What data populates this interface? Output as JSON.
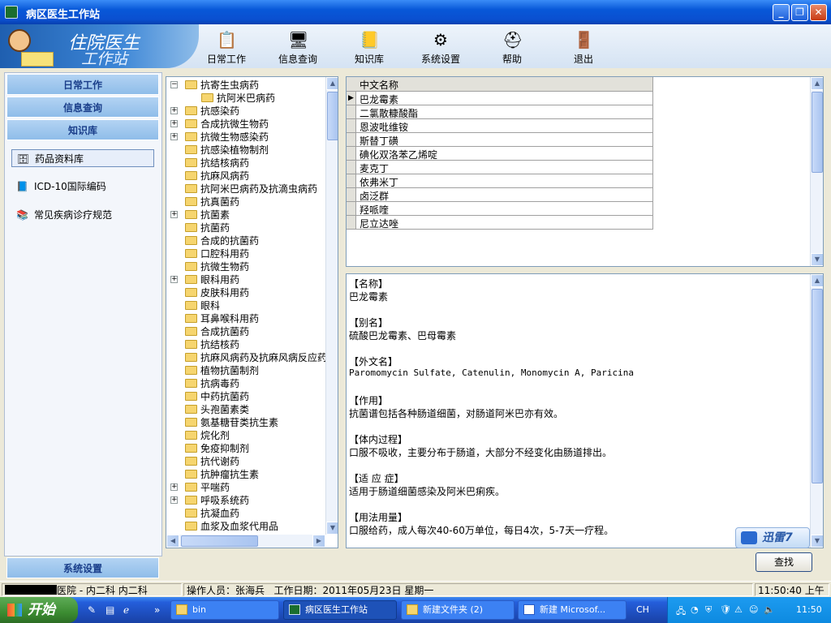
{
  "window": {
    "title": "病区医生工作站"
  },
  "logo": {
    "line1": "住院医生",
    "line2": "工作站"
  },
  "toolbar": [
    {
      "label": "日常工作",
      "icon": "clipboard-icon"
    },
    {
      "label": "信息查询",
      "icon": "search-info-icon"
    },
    {
      "label": "知识库",
      "icon": "book-icon"
    },
    {
      "label": "系统设置",
      "icon": "gear-icon"
    },
    {
      "label": "帮助",
      "icon": "lifebuoy-icon"
    },
    {
      "label": "退出",
      "icon": "exit-icon"
    }
  ],
  "sidebar": {
    "nav": [
      "日常工作",
      "信息查询",
      "知识库"
    ],
    "items": [
      {
        "label": "药品资料库"
      },
      {
        "label": "ICD-10国际编码"
      },
      {
        "label": "常见疾病诊疗规范"
      }
    ],
    "settings": "系统设置"
  },
  "tree": [
    {
      "label": "抗寄生虫病药",
      "exp": "−",
      "lvl": 0
    },
    {
      "label": "抗阿米巴病药",
      "exp": "",
      "lvl": 1
    },
    {
      "label": "抗感染药",
      "exp": "+",
      "lvl": 0
    },
    {
      "label": "合成抗微生物药",
      "exp": "+",
      "lvl": 0
    },
    {
      "label": "抗微生物感染药",
      "exp": "+",
      "lvl": 0
    },
    {
      "label": "抗感染植物制剂",
      "exp": "",
      "lvl": 0
    },
    {
      "label": "抗结核病药",
      "exp": "",
      "lvl": 0
    },
    {
      "label": "抗麻风病药",
      "exp": "",
      "lvl": 0
    },
    {
      "label": "抗阿米巴病药及抗滴虫病药",
      "exp": "",
      "lvl": 0
    },
    {
      "label": "抗真菌药",
      "exp": "",
      "lvl": 0
    },
    {
      "label": "抗菌素",
      "exp": "+",
      "lvl": 0
    },
    {
      "label": "抗菌药",
      "exp": "",
      "lvl": 0
    },
    {
      "label": "合成的抗菌药",
      "exp": "",
      "lvl": 0
    },
    {
      "label": "口腔科用药",
      "exp": "",
      "lvl": 0
    },
    {
      "label": "抗微生物药",
      "exp": "",
      "lvl": 0
    },
    {
      "label": "眼科用药",
      "exp": "+",
      "lvl": 0
    },
    {
      "label": "皮肤科用药",
      "exp": "",
      "lvl": 0
    },
    {
      "label": "眼科",
      "exp": "",
      "lvl": 0
    },
    {
      "label": "耳鼻喉科用药",
      "exp": "",
      "lvl": 0
    },
    {
      "label": "合成抗菌药",
      "exp": "",
      "lvl": 0
    },
    {
      "label": "抗结核药",
      "exp": "",
      "lvl": 0
    },
    {
      "label": "抗麻风病药及抗麻风病反应药",
      "exp": "",
      "lvl": 0
    },
    {
      "label": "植物抗菌制剂",
      "exp": "",
      "lvl": 0
    },
    {
      "label": "抗病毒药",
      "exp": "",
      "lvl": 0
    },
    {
      "label": "中药抗菌药",
      "exp": "",
      "lvl": 0
    },
    {
      "label": "头孢菌素类",
      "exp": "",
      "lvl": 0
    },
    {
      "label": "氨基糖苷类抗生素",
      "exp": "",
      "lvl": 0
    },
    {
      "label": "烷化剂",
      "exp": "",
      "lvl": 0
    },
    {
      "label": "免疫抑制剂",
      "exp": "",
      "lvl": 0
    },
    {
      "label": "抗代谢药",
      "exp": "",
      "lvl": 0
    },
    {
      "label": "抗肿瘤抗生素",
      "exp": "",
      "lvl": 0
    },
    {
      "label": "平喘药",
      "exp": "+",
      "lvl": 0
    },
    {
      "label": "呼吸系统药",
      "exp": "+",
      "lvl": 0
    },
    {
      "label": "抗凝血药",
      "exp": "",
      "lvl": 0
    },
    {
      "label": "血浆及血浆代用品",
      "exp": "",
      "lvl": 0
    }
  ],
  "grid": {
    "header": "中文名称",
    "selected_marker": "▶",
    "rows": [
      "巴龙霉素",
      "二氯散糠酸酯",
      "恩波吡维铵",
      "斯替丁磺",
      "碘化双洛苯乙烯啶",
      "麦克丁",
      "依弗米丁",
      "卤泛群",
      "羟哌喹",
      "尼立达唑"
    ]
  },
  "detail": [
    {
      "h": "【名称】",
      "t": "巴龙霉素",
      "mono": false
    },
    {
      "h": "【别名】",
      "t": "硫酸巴龙霉素、巴母霉素",
      "mono": false
    },
    {
      "h": "【外文名】",
      "t": "Paromomycin Sulfate, Catenulin, Monomycin A, Paricina",
      "mono": true
    },
    {
      "h": "【作用】",
      "t": " 抗菌谱包括各种肠道细菌，对肠道阿米巴亦有效。",
      "mono": false
    },
    {
      "h": "【体内过程】",
      "t": " 口服不吸收，主要分布于肠道，大部分不经变化由肠道排出。",
      "mono": false
    },
    {
      "h": "【适 应 症】",
      "t": " 适用于肠道细菌感染及阿米巴痢疾。",
      "mono": false
    },
    {
      "h": "【用法用量】",
      "t": " 口服给药，成人每次40-60万单位，每日4次，5-7天一疗程。",
      "mono": false
    }
  ],
  "xunlei": "迅雷7",
  "find_button": "查找",
  "status": {
    "dept": "医院 - 内二科 内二科",
    "operator": "操作人员：张海兵",
    "date": "工作日期：2011年05月23日 星期一",
    "time": "11:50:40 上午"
  },
  "taskbar": {
    "start": "开始",
    "tasks": [
      "bin",
      "病区医生工作站",
      "新建文件夹 (2)",
      "新建 Microsof..."
    ],
    "lang": "CH",
    "clock": "11:50"
  }
}
